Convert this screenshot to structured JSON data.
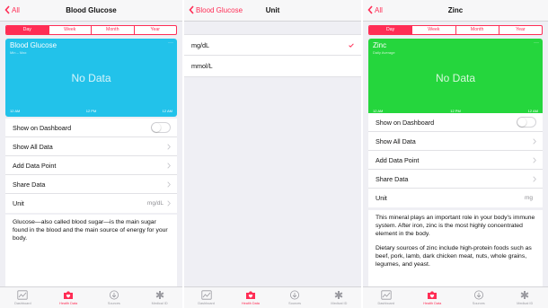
{
  "colors": {
    "accent": "#ff2d55",
    "glucose_card": "#22c2ea",
    "zinc_card": "#25d63d"
  },
  "glucose_screen": {
    "back_label": "All",
    "title": "Blood Glucose",
    "segments": [
      "Day",
      "Week",
      "Month",
      "Year"
    ],
    "active_segment": "Day",
    "card": {
      "title": "Blood Glucose",
      "subtitle": "Min – Max",
      "no_data": "No Data",
      "axis": [
        "12 AM",
        "12 PM",
        "12 AM"
      ]
    },
    "rows": {
      "show_on_dashboard": "Show on Dashboard",
      "show_all_data": "Show All Data",
      "add_data_point": "Add Data Point",
      "share_data": "Share Data",
      "unit": "Unit",
      "unit_value": "mg/dL"
    },
    "dashboard_toggle_on": false,
    "description": "Glucose—also called blood sugar—is the main sugar found in the blood and the main source of energy for your body."
  },
  "unit_screen": {
    "back_label": "Blood Glucose",
    "title": "Unit",
    "options": [
      "mg/dL",
      "mmol/L"
    ],
    "selected": "mg/dL"
  },
  "zinc_screen": {
    "back_label": "All",
    "title": "Zinc",
    "segments": [
      "Day",
      "Week",
      "Month",
      "Year"
    ],
    "active_segment": "Day",
    "card": {
      "title": "Zinc",
      "subtitle": "Daily Average",
      "no_data": "No Data",
      "axis": [
        "12 AM",
        "12 PM",
        "12 AM"
      ]
    },
    "rows": {
      "show_on_dashboard": "Show on Dashboard",
      "show_all_data": "Show All Data",
      "add_data_point": "Add Data Point",
      "share_data": "Share Data",
      "unit": "Unit",
      "unit_value": "mg"
    },
    "dashboard_toggle_on": false,
    "description_1": "This mineral plays an important role in your body's immune system. After iron, zinc is the most highly concentrated element in the body.",
    "description_2": "Dietary sources of zinc include high-protein foods such as beef, pork, lamb, dark chicken meat, nuts, whole grains, legumes, and yeast."
  },
  "tabbar": {
    "items": [
      {
        "label": "Dashboard",
        "icon": "dashboard-icon"
      },
      {
        "label": "Health Data",
        "icon": "health-data-icon"
      },
      {
        "label": "Sources",
        "icon": "sources-icon"
      },
      {
        "label": "Medical ID",
        "icon": "medical-id-icon"
      }
    ],
    "active": "Health Data"
  }
}
